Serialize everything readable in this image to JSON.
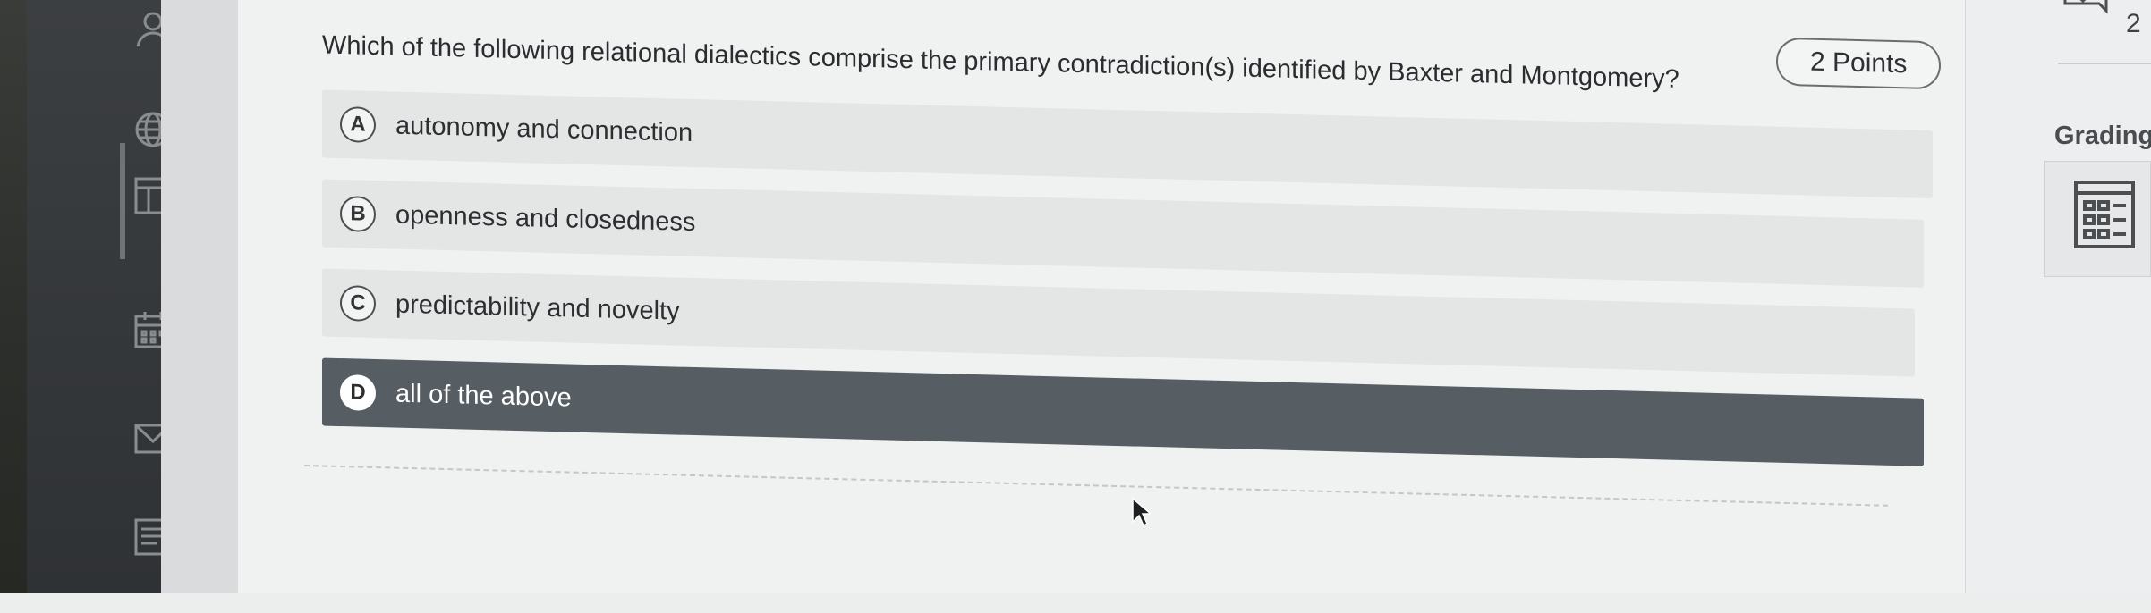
{
  "question": {
    "points_label": "2 Points",
    "text": "Which of the following relational dialectics comprise the primary contradiction(s) identified by Baxter and Montgomery?",
    "options": [
      {
        "letter": "A",
        "text": "autonomy and connection",
        "selected": false
      },
      {
        "letter": "B",
        "text": "openness and closedness",
        "selected": false
      },
      {
        "letter": "C",
        "text": "predictability and novelty",
        "selected": false
      },
      {
        "letter": "D",
        "text": "all of the above",
        "selected": true
      }
    ]
  },
  "right_panel": {
    "page_number": "2",
    "grading_label": "Grading"
  },
  "sidebar": {
    "icons": [
      "user-icon",
      "globe-icon",
      "layout-icon",
      "calendar-icon",
      "mail-icon",
      "document-icon"
    ]
  },
  "colors": {
    "selected_option_bg": "#565d63",
    "unselected_option_bg": "#e4e6e6",
    "sidebar_bg": "#34373a"
  }
}
